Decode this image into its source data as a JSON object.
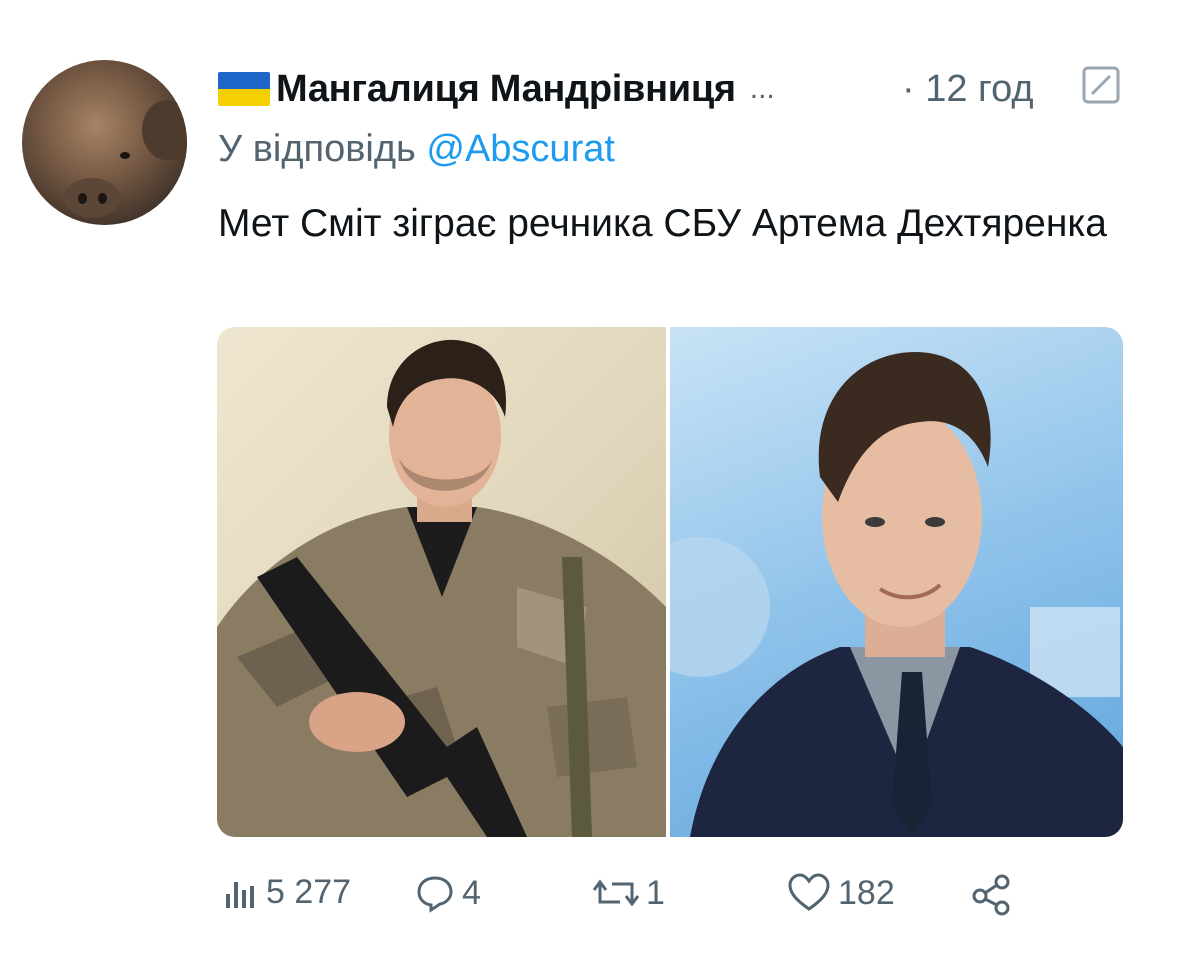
{
  "tweet": {
    "display_name": "Мангалиця Мандрівниця",
    "ellipsis": "...",
    "time": "· 12 год",
    "reply_prefix": "У відповідь",
    "reply_handle": "@Abscurat",
    "text": "Мет Сміт зіграє речника СБУ Артема Дехтяренка"
  },
  "actions": {
    "views": "5 277",
    "replies": "4",
    "retweets": "1",
    "likes": "182"
  },
  "icons": [
    "ukraine-flag-icon",
    "grok-icon",
    "views-icon",
    "reply-icon",
    "retweet-icon",
    "like-icon",
    "share-icon"
  ],
  "colors": {
    "link": "#1d9bf0",
    "secondary": "#536471",
    "text": "#0f1419"
  }
}
